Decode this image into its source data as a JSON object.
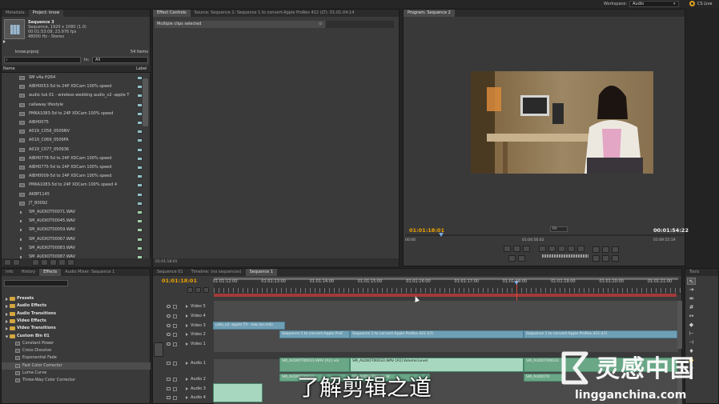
{
  "menu": {
    "workspace_label": "Workspace:",
    "workspace_value": "Audio",
    "cs_live": "CS Live"
  },
  "project_panel": {
    "tabs": [
      "Metadata",
      "Project: know"
    ],
    "clip_name": "Sequence 3",
    "clip_info": [
      "Sequence, 1920 x 1080 (1.0)",
      "00:01:53:08, 23.976 fps",
      "48000 Hz - Stereo"
    ],
    "project_file": "know.prproj",
    "item_count": "54 Items",
    "in_label": "In:",
    "in_value": "All",
    "columns": {
      "name": "Name",
      "label": "Label"
    },
    "items": [
      {
        "name": "SM v4a H264",
        "type": "video",
        "label_color": "#8fc0c4"
      },
      {
        "name": "AIBH0053-5d to 24P XDCam 100% speed",
        "type": "video",
        "label_color": "#8fc0c4"
      },
      {
        "name": "audio tuk 01 - wireless wedding audio_v2 -apple T",
        "type": "video",
        "label_color": "#8fc0c4"
      },
      {
        "name": "callaway lifestyle",
        "type": "video",
        "label_color": "#8fc0c4"
      },
      {
        "name": "PMKA1083-5d to 24P XDCam 100% speed",
        "type": "video",
        "label_color": "#8fc0c4"
      },
      {
        "name": "AIBH0075",
        "type": "video",
        "label_color": "#8fc0c4"
      },
      {
        "name": "A019_C056_0509NV",
        "type": "video",
        "label_color": "#8fc0c4"
      },
      {
        "name": "A019_C069_0509FA",
        "type": "video",
        "label_color": "#8fc0c4"
      },
      {
        "name": "A019_C077_050936",
        "type": "video",
        "label_color": "#8fc0c4"
      },
      {
        "name": "AIBH0778-5d to 24P XDCam 100% speed",
        "type": "video",
        "label_color": "#8fc0c4"
      },
      {
        "name": "AIBH0775-5d to 24P XDCam 100% speed",
        "type": "video",
        "label_color": "#8fc0c4"
      },
      {
        "name": "AIBH0009-5d to 24P XDCam 100% speed",
        "type": "video",
        "label_color": "#8fc0c4"
      },
      {
        "name": "PMKA1083-5d to 24P XDCam 100% speed 4",
        "type": "video",
        "label_color": "#8fc0c4"
      },
      {
        "name": "AKBP1145",
        "type": "video",
        "label_color": "#8fc0c4"
      },
      {
        "name": "JT_B0092",
        "type": "video",
        "label_color": "#8fc0c4"
      },
      {
        "name": "SM_AUDIOT00071.WAV",
        "type": "audio",
        "label_color": "#9fd0a6"
      },
      {
        "name": "SM_AUDIOT00045.WAV",
        "type": "audio",
        "label_color": "#9fd0a6"
      },
      {
        "name": "SM_AUDIOT00059.WAV",
        "type": "audio",
        "label_color": "#9fd0a6"
      },
      {
        "name": "SM_AUDIOT00067.WAV",
        "type": "audio",
        "label_color": "#9fd0a6"
      },
      {
        "name": "SM_AUDIOT00083.WAV",
        "type": "audio",
        "label_color": "#9fd0a6"
      },
      {
        "name": "SM_AUDIOT00087.WAV",
        "type": "audio",
        "label_color": "#9fd0a6"
      }
    ]
  },
  "effect_controls": {
    "tabs": [
      "Effect Controls",
      "Source: Sequence 1: Sequence 1 to convert-Apple ProRes 422 (LT): 01:01:04:14"
    ],
    "status": "Multiple clips selected",
    "timecode": "01:01:18:01"
  },
  "program_monitor": {
    "tab": "Program: Sequence 2",
    "current_time": "01:01:18:01",
    "duration": "00:01:54:22",
    "zoom": "Fit",
    "ruler_labels": [
      "00:00",
      "01:04:56:02",
      "01:09:55:19"
    ]
  },
  "effects_panel": {
    "tabs": [
      "Info",
      "History",
      "Effects",
      "Audio Mixer: Sequence 1"
    ],
    "items": [
      {
        "label": "Presets",
        "kind": "folder"
      },
      {
        "label": "Audio Effects",
        "kind": "folder"
      },
      {
        "label": "Audio Transitions",
        "kind": "folder"
      },
      {
        "label": "Video Effects",
        "kind": "folder"
      },
      {
        "label": "Video Transitions",
        "kind": "folder"
      },
      {
        "label": "Custom Bin 01",
        "kind": "folder-open"
      },
      {
        "label": "Constant Power",
        "kind": "effect"
      },
      {
        "label": "Cross Dissolve",
        "kind": "effect"
      },
      {
        "label": "Exponential Fade",
        "kind": "effect"
      },
      {
        "label": "Fast Color Corrector",
        "kind": "effect-selected"
      },
      {
        "label": "Luma Curve",
        "kind": "effect"
      },
      {
        "label": "Three-Way Color Corrector",
        "kind": "effect"
      }
    ]
  },
  "timeline": {
    "tabs": [
      "Sequence 01",
      "Timeline: (no sequences)",
      "Sequence 1"
    ],
    "current_time": "01:01:18:01",
    "ruler_labels": [
      "01:01:12:00",
      "01:01:13:00",
      "01:01:14:00",
      "01:01:15:00",
      "01:01:16:00",
      "01:01:17:00",
      "01:01:18:00",
      "01:01:19:00",
      "01:01:20:00",
      "01:01:21:00"
    ],
    "video_tracks": [
      "Video 5",
      "Video 4",
      "Video 3",
      "Video 2",
      "Video 1"
    ],
    "audio_tracks": [
      "Audio 1",
      "Audio 2",
      "Audio 3",
      "Audio 4"
    ],
    "clips": {
      "v3_a": "udio_v2 -apple TV - low res.m4v",
      "v2_a": "Sequence 1 to convert-Apple ProF",
      "v2_b": "Sequence 1 to convert-Apple ProRes 422 (LT)",
      "v2_c": "Sequence 1 to convert-Apple ProRes 422 (LT)",
      "a1_a": "SM_AUDIOT00033.WAV [A1] vol",
      "a1_b": "SM_AUDIOT00033.WAV [A1]",
      "a1_c": "Volume:Level",
      "a1_d": "SM_AUDIOT00033",
      "a2_a": "SM_AUDIOT00033",
      "a2_b": "SM_AUDIOT00033.W",
      "a2_c": "SM_AUDIOT0"
    }
  },
  "tools_panel": {
    "title": "Tools"
  },
  "subtitle": "了解剪辑之道",
  "watermark": {
    "logo_text": "灵感中国",
    "url": "lingganchina.com"
  }
}
